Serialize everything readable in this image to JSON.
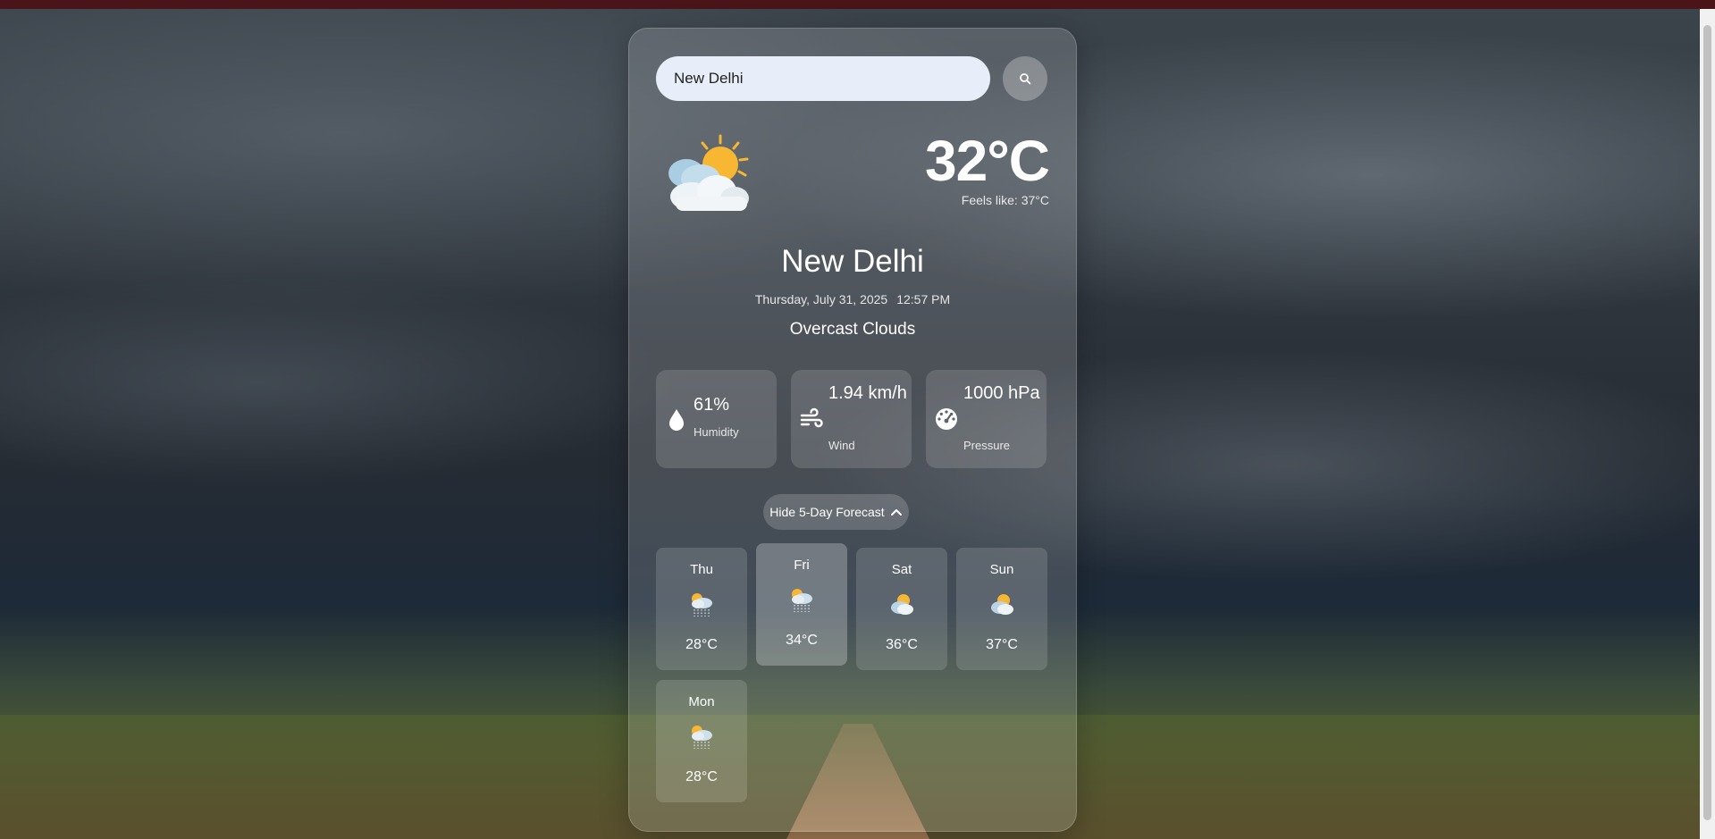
{
  "search": {
    "value": "New Delhi",
    "button_icon": "search-icon"
  },
  "current": {
    "temperature": "32°C",
    "feels_like": "Feels like: 37°C",
    "city": "New Delhi",
    "date": "Thursday, July 31, 2025",
    "time": "12:57 PM",
    "condition": "Overcast Clouds",
    "icon": "partly-cloudy-icon"
  },
  "stats": [
    {
      "icon": "droplet-icon",
      "value": "61%",
      "label": "Humidity"
    },
    {
      "icon": "wind-icon",
      "value": "1.94 km/h",
      "label": "Wind"
    },
    {
      "icon": "gauge-icon",
      "value": "1000 hPa",
      "label": "Pressure"
    }
  ],
  "forecast_toggle": {
    "label": "Hide 5-Day Forecast",
    "icon": "chevron-up-icon"
  },
  "forecast": [
    {
      "day": "Thu",
      "temp": "28°C",
      "icon": "rain-cloud-icon"
    },
    {
      "day": "Fri",
      "temp": "34°C",
      "icon": "rain-cloud-icon",
      "active": true
    },
    {
      "day": "Sat",
      "temp": "36°C",
      "icon": "sun-cloud-icon"
    },
    {
      "day": "Sun",
      "temp": "37°C",
      "icon": "sun-cloud-icon"
    },
    {
      "day": "Mon",
      "temp": "28°C",
      "icon": "rain-cloud-icon"
    }
  ],
  "colors": {
    "top_bar": "#4a1418",
    "search_field": "#e8eef9",
    "sun": "#f7b733"
  }
}
